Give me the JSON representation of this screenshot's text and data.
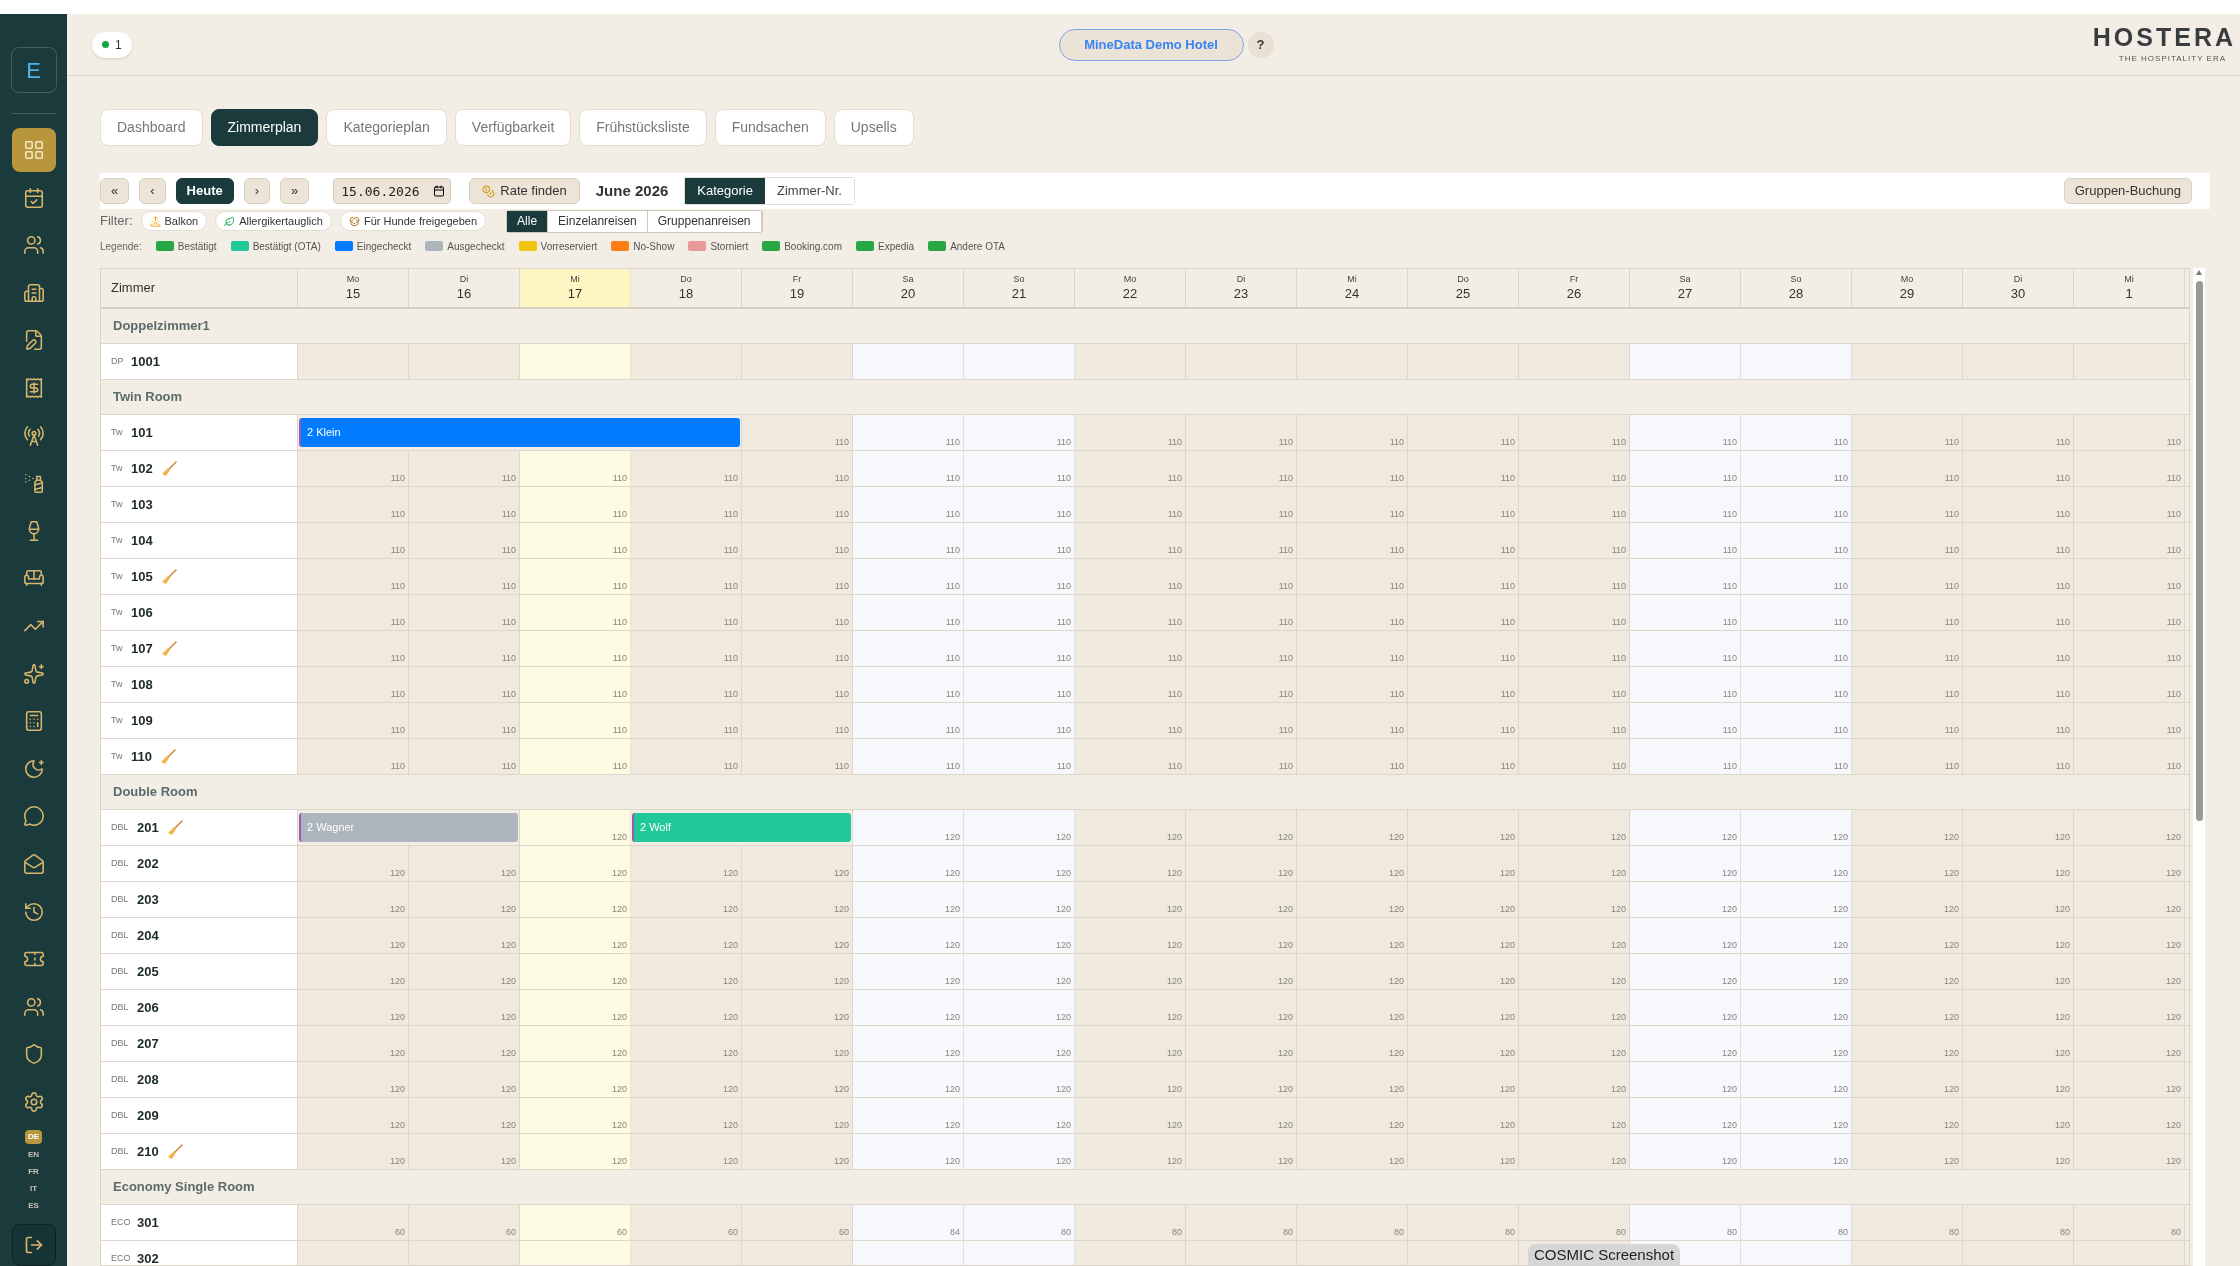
{
  "sidebar": {
    "brand": "E",
    "items": [
      {
        "selected": true
      },
      {
        "selected": false
      },
      {
        "selected": false
      },
      {
        "selected": false
      },
      {
        "selected": false
      },
      {
        "selected": false
      },
      {
        "selected": false
      },
      {
        "selected": false
      },
      {
        "selected": false
      },
      {
        "selected": false
      },
      {
        "selected": false
      },
      {
        "selected": false
      },
      {
        "selected": false
      },
      {
        "selected": false
      },
      {
        "selected": false
      },
      {
        "selected": false
      },
      {
        "selected": false
      },
      {
        "selected": false
      },
      {
        "selected": false
      },
      {
        "selected": false
      },
      {
        "selected": false
      }
    ],
    "languages": [
      {
        "label": "DE",
        "selected": true
      },
      {
        "label": "EN",
        "selected": false
      },
      {
        "label": "FR",
        "selected": false
      },
      {
        "label": "IT",
        "selected": false
      },
      {
        "label": "ES",
        "selected": false
      }
    ]
  },
  "header": {
    "status_count": "1",
    "hotel": "MineData Demo Hotel",
    "help": "?",
    "logo": "HOSTERA",
    "logo_tagline": "THE HOSPITALITY ERA"
  },
  "tabs": [
    {
      "label": "Dashboard",
      "selected": false
    },
    {
      "label": "Zimmerplan",
      "selected": true
    },
    {
      "label": "Kategorieplan",
      "selected": false
    },
    {
      "label": "Verfügbarkeit",
      "selected": false
    },
    {
      "label": "Frühstücksliste",
      "selected": false
    },
    {
      "label": "Fundsachen",
      "selected": false
    },
    {
      "label": "Upsells",
      "selected": false
    }
  ],
  "toolbar": {
    "first": "«",
    "prev": "‹",
    "today": "Heute",
    "next": "›",
    "last": "»",
    "date": "15.06.2026",
    "rate": "Rate finden",
    "month": "June 2026",
    "views": [
      {
        "label": "Kategorie",
        "selected": true
      },
      {
        "label": "Zimmer-Nr.",
        "selected": false
      }
    ],
    "group_booking": "Gruppen-Buchung"
  },
  "filter": {
    "label": "Filter:",
    "chips": [
      {
        "label": "Balkon"
      },
      {
        "label": "Allergikertauglich"
      },
      {
        "label": "Für Hunde freigegeben"
      }
    ],
    "arrivals": [
      {
        "label": "Alle",
        "selected": true
      },
      {
        "label": "Einzelanreisen",
        "selected": false
      },
      {
        "label": "Gruppenanreisen",
        "selected": false
      }
    ]
  },
  "legend": {
    "label": "Legende:",
    "items": [
      {
        "label": "Bestätigt",
        "color": "#28a745"
      },
      {
        "label": "Bestätigt (OTA)",
        "color": "#20c997"
      },
      {
        "label": "Eingecheckt",
        "color": "#007bff"
      },
      {
        "label": "Ausgecheckt",
        "color": "#adb5bd"
      },
      {
        "label": "Vorreserviert",
        "color": "#f1c40f"
      },
      {
        "label": "No-Show",
        "color": "#fd7e14"
      },
      {
        "label": "Storniert",
        "color": "#e89a9a"
      },
      {
        "label": "Booking.com",
        "color": "#28a745"
      },
      {
        "label": "Expedia",
        "color": "#28a745"
      },
      {
        "label": "Andere OTA",
        "color": "#28a745"
      }
    ]
  },
  "grid": {
    "room_column": "Zimmer",
    "days": [
      {
        "weekday": "Mo",
        "day": "15",
        "today": false,
        "weekend": false
      },
      {
        "weekday": "Di",
        "day": "16",
        "today": false,
        "weekend": false
      },
      {
        "weekday": "Mi",
        "day": "17",
        "today": true,
        "weekend": false
      },
      {
        "weekday": "Do",
        "day": "18",
        "today": false,
        "weekend": false
      },
      {
        "weekday": "Fr",
        "day": "19",
        "today": false,
        "weekend": false
      },
      {
        "weekday": "Sa",
        "day": "20",
        "today": false,
        "weekend": true
      },
      {
        "weekday": "So",
        "day": "21",
        "today": false,
        "weekend": true
      },
      {
        "weekday": "Mo",
        "day": "22",
        "today": false,
        "weekend": false
      },
      {
        "weekday": "Di",
        "day": "23",
        "today": false,
        "weekend": false
      },
      {
        "weekday": "Mi",
        "day": "24",
        "today": false,
        "weekend": false
      },
      {
        "weekday": "Do",
        "day": "25",
        "today": false,
        "weekend": false
      },
      {
        "weekday": "Fr",
        "day": "26",
        "today": false,
        "weekend": false
      },
      {
        "weekday": "Sa",
        "day": "27",
        "today": false,
        "weekend": true
      },
      {
        "weekday": "So",
        "day": "28",
        "today": false,
        "weekend": true
      },
      {
        "weekday": "Mo",
        "day": "29",
        "today": false,
        "weekend": false
      },
      {
        "weekday": "Di",
        "day": "30",
        "today": false,
        "weekend": false
      },
      {
        "weekday": "Mi",
        "day": "1",
        "today": false,
        "weekend": false
      }
    ],
    "groups": [
      {
        "name": "Doppelzimmer1",
        "rooms": [
          {
            "type": "DP",
            "number": "1001",
            "cleaning": false,
            "cells": [
              null,
              null,
              null,
              null,
              null,
              null,
              null,
              null,
              null,
              null,
              null,
              null,
              null,
              null,
              null,
              null,
              null
            ]
          }
        ]
      },
      {
        "name": "Twin Room",
        "rooms": [
          {
            "type": "Tw",
            "number": "101",
            "cleaning": false,
            "cells": [
              {
                "kind": "booking",
                "text": "2 Klein",
                "color": "#007bff"
              },
              {
                "kind": "covered"
              },
              {
                "kind": "covered"
              },
              {
                "kind": "covered"
              },
              "110",
              "110",
              "110",
              "110",
              "110",
              "110",
              "110",
              "110",
              "110",
              "110",
              "110",
              "110",
              "110"
            ]
          },
          {
            "type": "Tw",
            "number": "102",
            "cleaning": true,
            "cells": [
              "110",
              "110",
              "110",
              "110",
              "110",
              "110",
              "110",
              "110",
              "110",
              "110",
              "110",
              "110",
              "110",
              "110",
              "110",
              "110",
              "110"
            ]
          },
          {
            "type": "Tw",
            "number": "103",
            "cleaning": false,
            "cells": [
              "110",
              "110",
              "110",
              "110",
              "110",
              "110",
              "110",
              "110",
              "110",
              "110",
              "110",
              "110",
              "110",
              "110",
              "110",
              "110",
              "110"
            ]
          },
          {
            "type": "Tw",
            "number": "104",
            "cleaning": false,
            "cells": [
              "110",
              "110",
              "110",
              "110",
              "110",
              "110",
              "110",
              "110",
              "110",
              "110",
              "110",
              "110",
              "110",
              "110",
              "110",
              "110",
              "110"
            ]
          },
          {
            "type": "Tw",
            "number": "105",
            "cleaning": true,
            "cells": [
              "110",
              "110",
              "110",
              "110",
              "110",
              "110",
              "110",
              "110",
              "110",
              "110",
              "110",
              "110",
              "110",
              "110",
              "110",
              "110",
              "110"
            ]
          },
          {
            "type": "Tw",
            "number": "106",
            "cleaning": false,
            "cells": [
              "110",
              "110",
              "110",
              "110",
              "110",
              "110",
              "110",
              "110",
              "110",
              "110",
              "110",
              "110",
              "110",
              "110",
              "110",
              "110",
              "110"
            ]
          },
          {
            "type": "Tw",
            "number": "107",
            "cleaning": true,
            "cells": [
              "110",
              "110",
              "110",
              "110",
              "110",
              "110",
              "110",
              "110",
              "110",
              "110",
              "110",
              "110",
              "110",
              "110",
              "110",
              "110",
              "110"
            ]
          },
          {
            "type": "Tw",
            "number": "108",
            "cleaning": false,
            "cells": [
              "110",
              "110",
              "110",
              "110",
              "110",
              "110",
              "110",
              "110",
              "110",
              "110",
              "110",
              "110",
              "110",
              "110",
              "110",
              "110",
              "110"
            ]
          },
          {
            "type": "Tw",
            "number": "109",
            "cleaning": false,
            "cells": [
              "110",
              "110",
              "110",
              "110",
              "110",
              "110",
              "110",
              "110",
              "110",
              "110",
              "110",
              "110",
              "110",
              "110",
              "110",
              "110",
              "110"
            ]
          },
          {
            "type": "Tw",
            "number": "110",
            "cleaning": true,
            "cells": [
              "110",
              "110",
              "110",
              "110",
              "110",
              "110",
              "110",
              "110",
              "110",
              "110",
              "110",
              "110",
              "110",
              "110",
              "110",
              "110",
              "110"
            ]
          }
        ]
      },
      {
        "name": "Double Room",
        "rooms": [
          {
            "type": "DBL",
            "number": "201",
            "cleaning": true,
            "cells": [
              {
                "kind": "booking",
                "text": "2 Wagner",
                "color": "#adb5bd"
              },
              {
                "kind": "covered"
              },
              "120",
              {
                "kind": "booking",
                "text": "2 Wolf",
                "color": "#20c997"
              },
              {
                "kind": "covered"
              },
              "120",
              "120",
              "120",
              "120",
              "120",
              "120",
              "120",
              "120",
              "120",
              "120",
              "120",
              "120"
            ]
          },
          {
            "type": "DBL",
            "number": "202",
            "cleaning": false,
            "cells": [
              "120",
              "120",
              "120",
              "120",
              "120",
              "120",
              "120",
              "120",
              "120",
              "120",
              "120",
              "120",
              "120",
              "120",
              "120",
              "120",
              "120"
            ]
          },
          {
            "type": "DBL",
            "number": "203",
            "cleaning": false,
            "cells": [
              "120",
              "120",
              "120",
              "120",
              "120",
              "120",
              "120",
              "120",
              "120",
              "120",
              "120",
              "120",
              "120",
              "120",
              "120",
              "120",
              "120"
            ]
          },
          {
            "type": "DBL",
            "number": "204",
            "cleaning": false,
            "cells": [
              "120",
              "120",
              "120",
              "120",
              "120",
              "120",
              "120",
              "120",
              "120",
              "120",
              "120",
              "120",
              "120",
              "120",
              "120",
              "120",
              "120"
            ]
          },
          {
            "type": "DBL",
            "number": "205",
            "cleaning": false,
            "cells": [
              "120",
              "120",
              "120",
              "120",
              "120",
              "120",
              "120",
              "120",
              "120",
              "120",
              "120",
              "120",
              "120",
              "120",
              "120",
              "120",
              "120"
            ]
          },
          {
            "type": "DBL",
            "number": "206",
            "cleaning": false,
            "cells": [
              "120",
              "120",
              "120",
              "120",
              "120",
              "120",
              "120",
              "120",
              "120",
              "120",
              "120",
              "120",
              "120",
              "120",
              "120",
              "120",
              "120"
            ]
          },
          {
            "type": "DBL",
            "number": "207",
            "cleaning": false,
            "cells": [
              "120",
              "120",
              "120",
              "120",
              "120",
              "120",
              "120",
              "120",
              "120",
              "120",
              "120",
              "120",
              "120",
              "120",
              "120",
              "120",
              "120"
            ]
          },
          {
            "type": "DBL",
            "number": "208",
            "cleaning": false,
            "cells": [
              "120",
              "120",
              "120",
              "120",
              "120",
              "120",
              "120",
              "120",
              "120",
              "120",
              "120",
              "120",
              "120",
              "120",
              "120",
              "120",
              "120"
            ]
          },
          {
            "type": "DBL",
            "number": "209",
            "cleaning": false,
            "cells": [
              "120",
              "120",
              "120",
              "120",
              "120",
              "120",
              "120",
              "120",
              "120",
              "120",
              "120",
              "120",
              "120",
              "120",
              "120",
              "120",
              "120"
            ]
          },
          {
            "type": "DBL",
            "number": "210",
            "cleaning": true,
            "cells": [
              "120",
              "120",
              "120",
              "120",
              "120",
              "120",
              "120",
              "120",
              "120",
              "120",
              "120",
              "120",
              "120",
              "120",
              "120",
              "120",
              "120"
            ]
          }
        ]
      },
      {
        "name": "Economy Single Room",
        "rooms": [
          {
            "type": "ECO",
            "number": "301",
            "cleaning": false,
            "cells": [
              "60",
              "60",
              "60",
              "60",
              "60",
              "84",
              "80",
              "80",
              "80",
              "80",
              "80",
              "80",
              "80",
              "80",
              "80",
              "80",
              "80"
            ]
          },
          {
            "type": "ECO",
            "number": "302",
            "cleaning": false,
            "cells": [
              null,
              null,
              null,
              null,
              null,
              null,
              null,
              null,
              null,
              null,
              null,
              null,
              null,
              null,
              null,
              null,
              null
            ]
          }
        ]
      }
    ]
  },
  "tooltip": "COSMIC Screenshot"
}
